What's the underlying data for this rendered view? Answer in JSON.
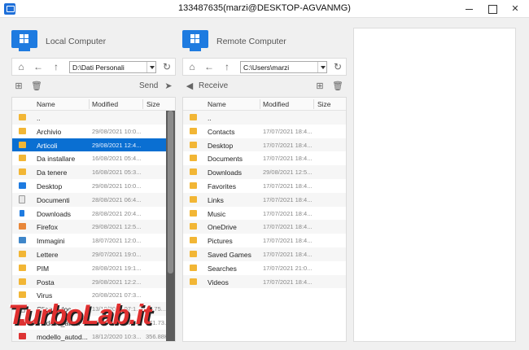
{
  "window": {
    "title": "133487635(marzi@DESKTOP-AGVANMG)"
  },
  "local": {
    "title": "Local Computer",
    "path": "D:\\Dati Personali",
    "action": "Send",
    "columns": [
      "Name",
      "Modified",
      "Size"
    ],
    "files": [
      {
        "name": "..",
        "modified": "",
        "size": "",
        "icon": "folder-icon"
      },
      {
        "name": "Archivio",
        "modified": "29/08/2021 10:0...",
        "size": "",
        "icon": "folder-icon"
      },
      {
        "name": "Articoli",
        "modified": "29/08/2021 12:4...",
        "size": "",
        "icon": "folder-icon",
        "selected": true
      },
      {
        "name": "Da installare",
        "modified": "16/08/2021 05:4...",
        "size": "",
        "icon": "folder-icon"
      },
      {
        "name": "Da tenere",
        "modified": "16/08/2021 05:3...",
        "size": "",
        "icon": "folder-icon"
      },
      {
        "name": "Desktop",
        "modified": "29/08/2021 10:0...",
        "size": "",
        "icon": "desktop-icon"
      },
      {
        "name": "Documenti",
        "modified": "28/08/2021 06:4...",
        "size": "",
        "icon": "documents-icon"
      },
      {
        "name": "Downloads",
        "modified": "28/08/2021 20:4...",
        "size": "",
        "icon": "download-icon"
      },
      {
        "name": "Firefox",
        "modified": "29/08/2021 12:5...",
        "size": "",
        "icon": "firefox-icon"
      },
      {
        "name": "Immagini",
        "modified": "18/07/2021 12:0...",
        "size": "",
        "icon": "pictures-icon"
      },
      {
        "name": "Lettere",
        "modified": "29/07/2021 19:0...",
        "size": "",
        "icon": "folder-icon"
      },
      {
        "name": "PIM",
        "modified": "28/08/2021 19:1...",
        "size": "",
        "icon": "folder-icon"
      },
      {
        "name": "Posta",
        "modified": "29/08/2021 12:2...",
        "size": "",
        "icon": "folder-icon"
      },
      {
        "name": "Virus",
        "modified": "20/08/2021 07:3...",
        "size": "",
        "icon": "folder-icon"
      },
      {
        "name": "Cliente.doc",
        "modified": "13/10/2020 07:1...",
        "size": "33.75...",
        "icon": "document-icon"
      },
      {
        "name": "modello_ato...",
        "modified": "18/12/2020 10:3...",
        "size": "371.73...",
        "icon": "pdf-icon"
      },
      {
        "name": "modello_autod...",
        "modified": "18/12/2020 10:3...",
        "size": "356.88K",
        "icon": "pdf-icon"
      }
    ]
  },
  "remote": {
    "title": "Remote Computer",
    "path": "C:\\Users\\marzi",
    "action": "Receive",
    "columns": [
      "Name",
      "Modified",
      "Size"
    ],
    "files": [
      {
        "name": "..",
        "modified": "",
        "size": ""
      },
      {
        "name": "Contacts",
        "modified": "17/07/2021 18:4...",
        "size": ""
      },
      {
        "name": "Desktop",
        "modified": "17/07/2021 18:4...",
        "size": ""
      },
      {
        "name": "Documents",
        "modified": "17/07/2021 18:4...",
        "size": ""
      },
      {
        "name": "Downloads",
        "modified": "29/08/2021 12:5...",
        "size": ""
      },
      {
        "name": "Favorites",
        "modified": "17/07/2021 18:4...",
        "size": ""
      },
      {
        "name": "Links",
        "modified": "17/07/2021 18:4...",
        "size": ""
      },
      {
        "name": "Music",
        "modified": "17/07/2021 18:4...",
        "size": ""
      },
      {
        "name": "OneDrive",
        "modified": "17/07/2021 18:4...",
        "size": ""
      },
      {
        "name": "Pictures",
        "modified": "17/07/2021 18:4...",
        "size": ""
      },
      {
        "name": "Saved Games",
        "modified": "17/07/2021 18:4...",
        "size": ""
      },
      {
        "name": "Searches",
        "modified": "17/07/2021 21:0...",
        "size": ""
      },
      {
        "name": "Videos",
        "modified": "17/07/2021 18:4...",
        "size": ""
      }
    ]
  },
  "watermark": "TurboLab.it",
  "colors": {
    "accent": "#0a6fd2",
    "folder": "#f2b635",
    "monitor": "#1e7be0"
  }
}
